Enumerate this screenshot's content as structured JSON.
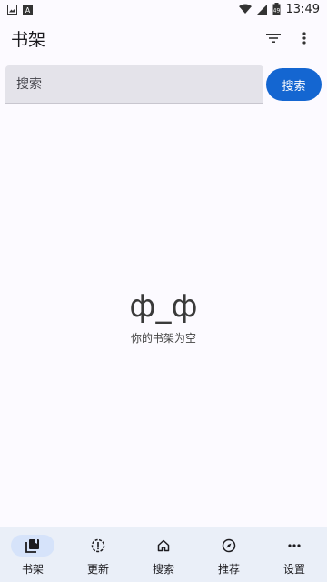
{
  "status_bar": {
    "time": "13:49",
    "battery_level": "49",
    "icons": [
      "image-notification-icon",
      "text-notification-icon",
      "wifi-icon",
      "cellular-signal-icon",
      "battery-icon"
    ]
  },
  "app_bar": {
    "title": "书架",
    "icons": [
      "filter-icon",
      "more-vert-icon"
    ]
  },
  "search": {
    "placeholder": "搜索",
    "value": "",
    "button_label": "搜索"
  },
  "empty_state": {
    "face": "ф_ф",
    "message": "你的书架为空"
  },
  "bottom_nav": {
    "items": [
      {
        "label": "书架",
        "icon": "bookshelf-icon",
        "active": true
      },
      {
        "label": "更新",
        "icon": "alert-circle-icon",
        "active": false
      },
      {
        "label": "搜索",
        "icon": "home-icon",
        "active": false
      },
      {
        "label": "推荐",
        "icon": "compass-icon",
        "active": false
      },
      {
        "label": "设置",
        "icon": "more-horiz-icon",
        "active": false
      }
    ]
  },
  "colors": {
    "background": "#fcfaff",
    "accent": "#1466d1",
    "nav_background": "#eaeff8",
    "nav_active_pill": "#d6e3fa",
    "search_field": "#e4e3ea"
  }
}
